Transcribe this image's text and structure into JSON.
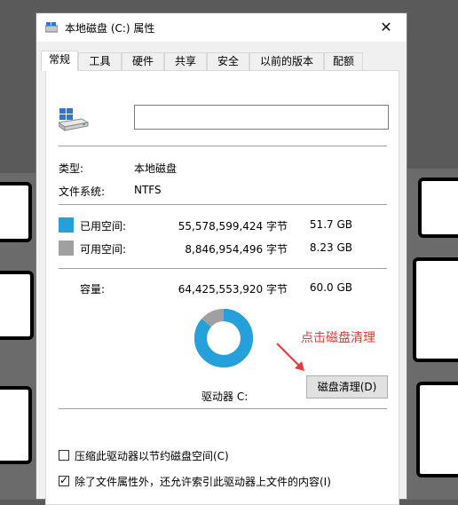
{
  "window": {
    "title": "本地磁盘 (C:) 属性",
    "close_glyph": "✕"
  },
  "tabs": [
    {
      "label": "常规",
      "active": true
    },
    {
      "label": "工具"
    },
    {
      "label": "硬件"
    },
    {
      "label": "共享"
    },
    {
      "label": "安全"
    },
    {
      "label": "以前的版本"
    },
    {
      "label": "配额"
    }
  ],
  "general": {
    "drive_name_value": "",
    "type_label": "类型:",
    "type_value": "本地磁盘",
    "fs_label": "文件系统:",
    "fs_value": "NTFS",
    "used": {
      "label": "已用空间:",
      "bytes": "55,578,599,424 字节",
      "size": "51.7 GB",
      "color": "#26a0da"
    },
    "free": {
      "label": "可用空间:",
      "bytes": "8,846,954,496 字节",
      "size": "8.23 GB",
      "color": "#a0a0a0"
    },
    "capacity": {
      "label": "容量:",
      "bytes": "64,425,553,920 字节",
      "size": "60.0 GB"
    },
    "used_fraction": 0.863,
    "drive_label": "驱动器 C:",
    "cleanup_button": "磁盘清理(D)",
    "annotation": "点击磁盘清理",
    "annotation_color": "#e43b3b",
    "compress_option": {
      "label": "压缩此驱动器以节约磁盘空间(C)",
      "checked": false
    },
    "index_option": {
      "label": "除了文件属性外，还允许索引此驱动器上文件的内容(I)",
      "checked": true,
      "check_glyph": "✓"
    }
  },
  "icons": [
    "drive-icon",
    "close-icon",
    "checkbox-icon"
  ]
}
